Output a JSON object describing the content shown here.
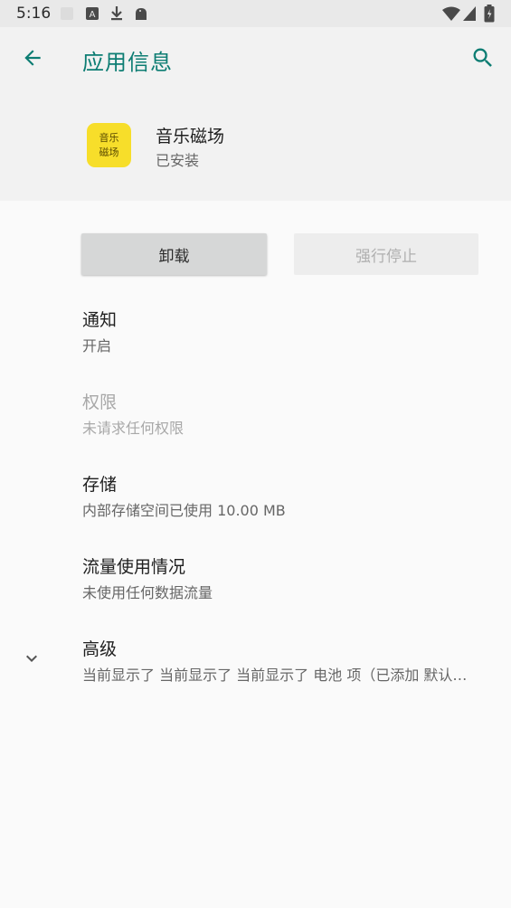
{
  "status_bar": {
    "time": "5:16",
    "icons": [
      "notification-placeholder-icon",
      "a-badge-icon",
      "download-icon",
      "android-icon",
      "wifi-icon",
      "signal-icon",
      "battery-icon"
    ]
  },
  "app_bar": {
    "back_icon": "arrow-back-icon",
    "title": "应用信息",
    "search_icon": "search-icon",
    "accent_color": "#0d7d73"
  },
  "app_header": {
    "icon_text_line1": "音乐",
    "icon_text_line2": "磁场",
    "icon_color": "#f7de2a",
    "name": "音乐磁场",
    "status": "已安装"
  },
  "actions": {
    "uninstall_label": "卸载",
    "force_stop_label": "强行停止"
  },
  "settings": {
    "notifications": {
      "title": "通知",
      "summary": "开启"
    },
    "permissions": {
      "title": "权限",
      "summary": "未请求任何权限"
    },
    "storage": {
      "title": "存储",
      "summary": "内部存储空间已使用 10.00 MB"
    },
    "data_usage": {
      "title": "流量使用情况",
      "summary": "未使用任何数据流量"
    },
    "advanced": {
      "title": "高级",
      "summary": "当前显示了 当前显示了 当前显示了 电池 项（已添加 默认…",
      "icon": "chevron-down-icon"
    }
  }
}
